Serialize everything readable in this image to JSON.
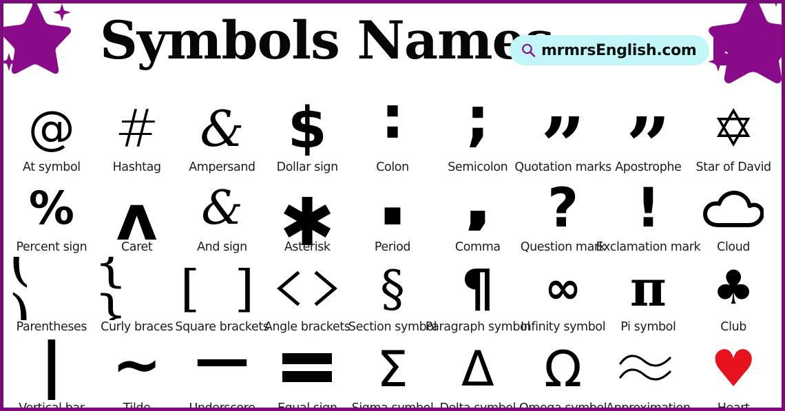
{
  "page": {
    "title": "Symbols Names",
    "border_color": "#7d0a7d",
    "accent_color": "#8a0b8a",
    "background": "#ffffff"
  },
  "decorations": {
    "star_top_left": "star-sparkle-icon",
    "star_top_right": "star-sparkle-icon",
    "star_color": "#8a0b8a"
  },
  "search": {
    "icon": "search-icon",
    "value": "mrmrsEnglish.com",
    "placeholder": "mrmrsEnglish.com",
    "button_label": "Search",
    "field_background": "#c3f6f8",
    "button_background": "#8a0b8a",
    "button_text_color": "#ffffff"
  },
  "grid": {
    "rows": [
      {
        "cells": [
          {
            "glyph": "@",
            "label": "At symbol",
            "icon": "at-symbol-icon",
            "style": "g-at"
          },
          {
            "glyph": "#",
            "label": "Hashtag",
            "icon": "hashtag-icon",
            "style": "g-hash"
          },
          {
            "glyph": "&",
            "label": "Ampersand",
            "icon": "ampersand-icon",
            "style": "g-amp-script"
          },
          {
            "glyph": "$",
            "label": "Dollar sign",
            "icon": "dollar-sign-icon",
            "style": "g-dollar"
          },
          {
            "glyph": ":",
            "label": "Colon",
            "icon": "colon-icon",
            "style": "g-colon"
          },
          {
            "glyph": ";",
            "label": "Semicolon",
            "icon": "semicolon-icon",
            "style": "g-semicolon"
          },
          {
            "glyph": "”",
            "label": "Quotation marks",
            "icon": "quotation-marks-icon",
            "style": "g-quotes"
          },
          {
            "glyph": "”",
            "label": "Apostrophe",
            "icon": "apostrophe-icon",
            "style": "g-apos"
          },
          {
            "glyph": "✡",
            "label": "Star of David",
            "icon": "star-of-david-icon",
            "style": "g-star6"
          }
        ]
      },
      {
        "cells": [
          {
            "glyph": "%",
            "label": "Percent sign",
            "icon": "percent-sign-icon",
            "style": "g-percent"
          },
          {
            "glyph": "ʌ",
            "label": "Caret",
            "icon": "caret-icon",
            "style": "g-caret"
          },
          {
            "glyph": "&",
            "label": "And sign",
            "icon": "and-sign-icon",
            "style": "g-amp2"
          },
          {
            "glyph": "✱",
            "label": "Asterisk",
            "icon": "asterisk-icon",
            "style": "g-asterisk"
          },
          {
            "glyph": ".",
            "label": "Period",
            "icon": "period-icon",
            "style": "g-period"
          },
          {
            "glyph": ",",
            "label": "Comma",
            "icon": "comma-icon",
            "style": "g-comma"
          },
          {
            "glyph": "?",
            "label": "Question mark",
            "icon": "question-mark-icon",
            "style": "g-question"
          },
          {
            "glyph": "!",
            "label": "Exclamation mark",
            "icon": "exclamation-mark-icon",
            "style": "g-exclam"
          },
          {
            "glyph": "☁",
            "label": "Cloud",
            "icon": "cloud-icon",
            "style": "g-cloud"
          }
        ]
      },
      {
        "cells": [
          {
            "glyph": "( )",
            "label": "Parentheses",
            "icon": "parentheses-icon",
            "style": "g-paren"
          },
          {
            "glyph": "{ }",
            "label": "Curly braces",
            "icon": "curly-braces-icon",
            "style": "g-brace"
          },
          {
            "glyph": "[ ]",
            "label": "Square brackets",
            "icon": "square-brackets-icon",
            "style": "g-bracket"
          },
          {
            "glyph": "〈 〉",
            "label": "Angle brackets",
            "icon": "angle-brackets-icon",
            "style": "g-angle"
          },
          {
            "glyph": "§",
            "label": "Section symbol",
            "icon": "section-symbol-icon",
            "style": "g-section"
          },
          {
            "glyph": "¶",
            "label": "Paragraph symbol",
            "icon": "paragraph-symbol-icon",
            "style": "g-pilcrow"
          },
          {
            "glyph": "∞",
            "label": "Infinity symbol",
            "icon": "infinity-symbol-icon",
            "style": "g-infinity"
          },
          {
            "glyph": "π",
            "label": "Pi symbol",
            "icon": "pi-symbol-icon",
            "style": "g-pi"
          },
          {
            "glyph": "♣",
            "label": "Club",
            "icon": "club-icon",
            "style": "g-club"
          }
        ]
      },
      {
        "cells": [
          {
            "glyph": "|",
            "label": "Vertical bar",
            "icon": "vertical-bar-icon",
            "style": "g-vbar"
          },
          {
            "glyph": "∼",
            "label": "Tilde",
            "icon": "tilde-icon",
            "style": "g-tilde"
          },
          {
            "glyph": "—",
            "label": "Underscore",
            "icon": "underscore-icon",
            "style": "g-underscore"
          },
          {
            "glyph": "=",
            "label": "Equal sign",
            "icon": "equal-sign-icon",
            "style": "g-equal"
          },
          {
            "glyph": "Σ",
            "label": "Sigma symbol",
            "icon": "sigma-symbol-icon",
            "style": "g-sigma"
          },
          {
            "glyph": "Δ",
            "label": "Delta symbol",
            "icon": "delta-symbol-icon",
            "style": "g-delta"
          },
          {
            "glyph": "Ω",
            "label": "Omega symbol",
            "icon": "omega-symbol-icon",
            "style": "g-omega"
          },
          {
            "glyph": "≈",
            "label": "Approximation",
            "icon": "approximation-icon",
            "style": "g-approx"
          },
          {
            "glyph": "♥",
            "label": "Heart",
            "icon": "heart-icon",
            "style": "g-heart"
          }
        ]
      }
    ]
  }
}
